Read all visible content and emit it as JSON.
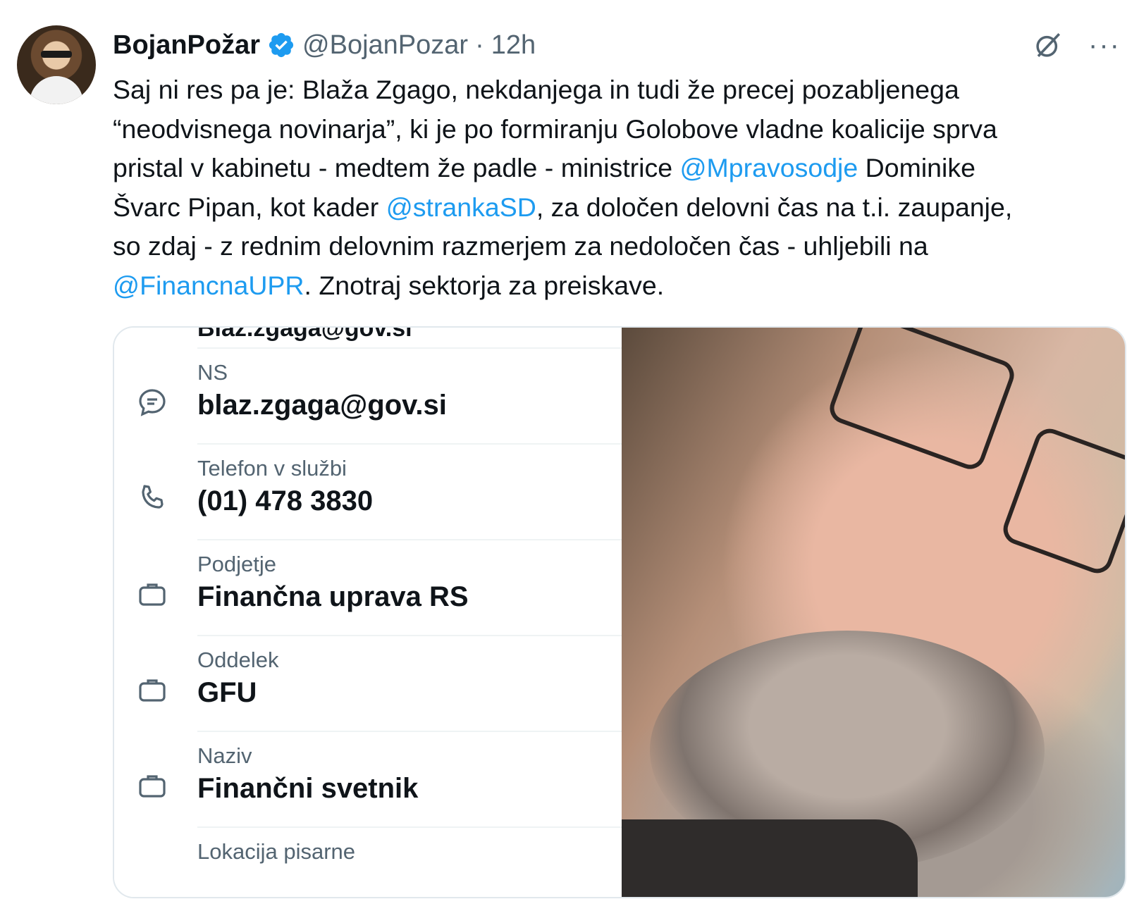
{
  "tweet": {
    "author_name": "BojanPožar",
    "handle": "@BojanPozar",
    "separator": "·",
    "time": "12h",
    "more_label": "···",
    "text_parts": [
      {
        "text": "Saj ni res pa je: Blaža Zgago, nekdanjega in tudi že precej pozabljenega\n“neodvisnega novinarja”, ki je po formiranju Golobove vladne koalicije sprva\npristal v kabinetu - medtem že padle - ministrice "
      },
      {
        "text": "@Mpravosodje",
        "mention": true
      },
      {
        "text": " Dominike\nŠvarc Pipan, kot kader "
      },
      {
        "text": "@strankaSD",
        "mention": true
      },
      {
        "text": ", za določen delovni čas na t.i. zaupanje,\nso zdaj - z rednim delovnim razmerjem za nedoločen čas - uhljebili na\n"
      },
      {
        "text": "@FinancnaUPR",
        "mention": true
      },
      {
        "text": ". Znotraj sektorja za preiskave."
      }
    ]
  },
  "card": {
    "cut_text": "Blaz.zgaga@gov.si",
    "rows": [
      {
        "icon": "chat-bubble-icon",
        "label": "NS",
        "value": "blaz.zgaga@gov.si"
      },
      {
        "icon": "phone-icon",
        "label": "Telefon v službi",
        "value": "(01) 478 3830"
      },
      {
        "icon": "briefcase-icon",
        "label": "Podjetje",
        "value": "Finančna uprava RS"
      },
      {
        "icon": "briefcase-icon",
        "label": "Oddelek",
        "value": "GFU"
      },
      {
        "icon": "briefcase-icon",
        "label": "Naziv",
        "value": "Finančni svetnik"
      },
      {
        "icon": "none",
        "label": "Lokacija pisarne",
        "value": ""
      }
    ]
  },
  "colors": {
    "mention": "#1d9bf0",
    "verified": "#1d9bf0",
    "secondary_text": "#536471"
  }
}
